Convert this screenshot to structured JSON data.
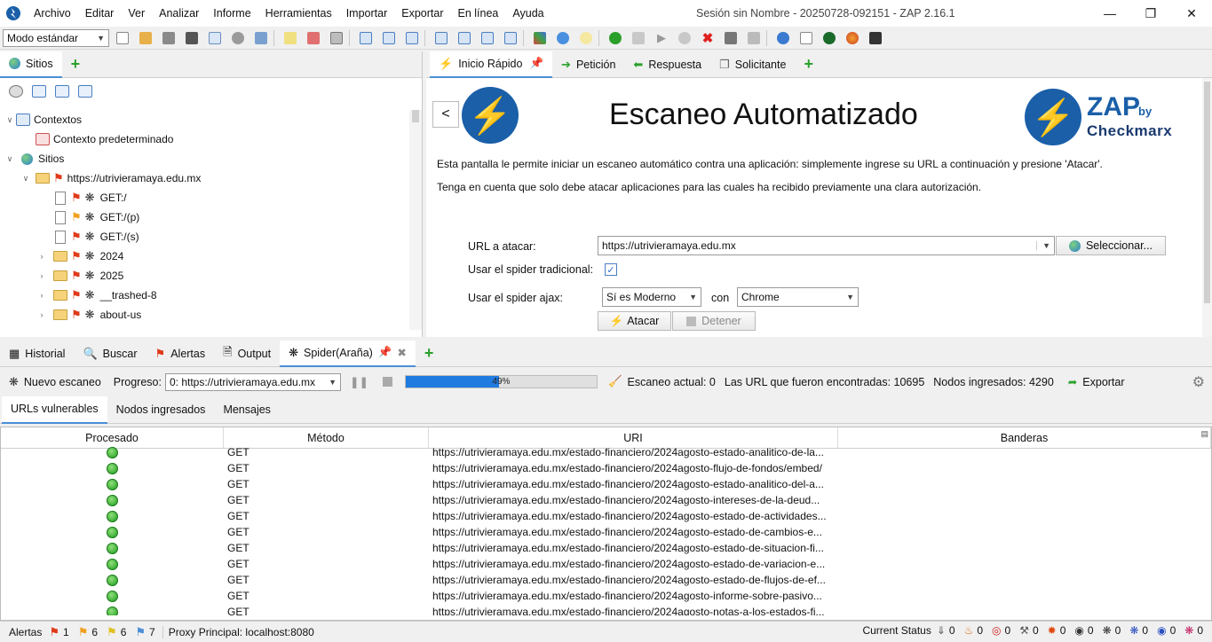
{
  "window": {
    "title": "Sesión sin Nombre - 20250728-092151 - ZAP 2.16.1",
    "menu": [
      "Archivo",
      "Editar",
      "Ver",
      "Analizar",
      "Informe",
      "Herramientas",
      "Importar",
      "Exportar",
      "En línea",
      "Ayuda"
    ]
  },
  "toolbar": {
    "mode": "Modo estándar"
  },
  "left_panel": {
    "tab": "Sitios",
    "tree": {
      "contexts": "Contextos",
      "default_context": "Contexto predeterminado",
      "sites": "Sitios",
      "host": "https://utrivieramaya.edu.mx",
      "nodes": [
        "GET:/",
        "GET:/(p)",
        "GET:/(s)",
        "2024",
        "2025",
        "__trashed-8",
        "about-us"
      ]
    }
  },
  "right_panel": {
    "tabs": [
      "Inicio Rápido",
      "Petición",
      "Respuesta",
      "Solicitante"
    ],
    "back_label": "<",
    "title": "Escaneo Automatizado",
    "brand": {
      "zap": "ZAP",
      "by": "by",
      "checkmarx": "Checkmarx"
    },
    "desc1": "Esta pantalla le permite iniciar un escaneo automático contra una aplicación: simplemente ingrese su URL a continuación y presione 'Atacar'.",
    "desc2": "Tenga en cuenta que solo debe atacar aplicaciones para las cuales ha recibido previamente una clara autorización.",
    "url_label": "URL a atacar:",
    "url_value": "https://utrivieramaya.edu.mx",
    "select_button": "Seleccionar...",
    "spider_label": "Usar el spider tradicional:",
    "ajax_label": "Usar el spider ajax:",
    "ajax_option": "Sí es Moderno",
    "with_label": "con",
    "browser": "Chrome",
    "attack_button": "Atacar",
    "stop_button": "Detener"
  },
  "bottom_panel": {
    "tabs": [
      "Historial",
      "Buscar",
      "Alertas",
      "Output",
      "Spider(Araña)"
    ],
    "new_scan": "Nuevo escaneo",
    "progress_label": "Progreso:",
    "progress_select": "0: https://utrivieramaya.edu.mx",
    "progress_pct": 49,
    "progress_text": "49%",
    "current_scan": "Escaneo actual: 0",
    "urls_found": "Las URL que fueron encontradas: 10695",
    "nodes_added": "Nodos ingresados: 4290",
    "export": "Exportar",
    "subtabs": [
      "URLs vulnerables",
      "Nodos ingresados",
      "Mensajes"
    ],
    "columns": [
      "Procesado",
      "Método",
      "URI",
      "Banderas"
    ],
    "rows": [
      {
        "method": "GET",
        "uri": "https://utrivieramaya.edu.mx/estado-financiero/2024agosto-estado-analitico-de-la..."
      },
      {
        "method": "GET",
        "uri": "https://utrivieramaya.edu.mx/estado-financiero/2024agosto-flujo-de-fondos/embed/"
      },
      {
        "method": "GET",
        "uri": "https://utrivieramaya.edu.mx/estado-financiero/2024agosto-estado-analitico-del-a..."
      },
      {
        "method": "GET",
        "uri": "https://utrivieramaya.edu.mx/estado-financiero/2024agosto-intereses-de-la-deud..."
      },
      {
        "method": "GET",
        "uri": "https://utrivieramaya.edu.mx/estado-financiero/2024agosto-estado-de-actividades..."
      },
      {
        "method": "GET",
        "uri": "https://utrivieramaya.edu.mx/estado-financiero/2024agosto-estado-de-cambios-e..."
      },
      {
        "method": "GET",
        "uri": "https://utrivieramaya.edu.mx/estado-financiero/2024agosto-estado-de-situacion-fi..."
      },
      {
        "method": "GET",
        "uri": "https://utrivieramaya.edu.mx/estado-financiero/2024agosto-estado-de-variacion-e..."
      },
      {
        "method": "GET",
        "uri": "https://utrivieramaya.edu.mx/estado-financiero/2024agosto-estado-de-flujos-de-ef..."
      },
      {
        "method": "GET",
        "uri": "https://utrivieramaya.edu.mx/estado-financiero/2024agosto-informe-sobre-pasivo..."
      },
      {
        "method": "GET",
        "uri": "https://utrivieramaya.edu.mx/estado-financiero/2024agosto-notas-a-los-estados-fi..."
      }
    ]
  },
  "statusbar": {
    "alerts_label": "Alertas",
    "high": "1",
    "medium": "6",
    "low": "6",
    "info": "7",
    "proxy": "Proxy Principal: localhost:8080",
    "current_status": "Current Status",
    "counters": [
      "0",
      "0",
      "0",
      "0",
      "0",
      "0",
      "0",
      "0",
      "0",
      "0"
    ]
  }
}
